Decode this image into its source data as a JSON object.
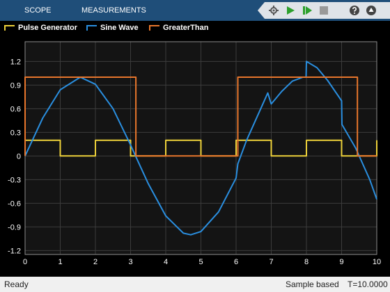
{
  "toolstrip": {
    "tabs": [
      "SCOPE",
      "MEASUREMENTS"
    ],
    "icons": [
      "settings-icon",
      "run-icon",
      "step-forward-icon",
      "stop-icon",
      "help-icon",
      "undock-icon"
    ]
  },
  "legend": [
    {
      "name": "Pulse Generator",
      "color": "#edd13a"
    },
    {
      "name": "Sine Wave",
      "color": "#2a8fe0"
    },
    {
      "name": "GreaterThan",
      "color": "#e8762c"
    }
  ],
  "chart_data": {
    "type": "line",
    "xlim": [
      0,
      10
    ],
    "ylim": [
      -1.25,
      1.45
    ],
    "x_ticks": [
      "0",
      "1",
      "2",
      "3",
      "4",
      "5",
      "6",
      "7",
      "8",
      "9",
      "10"
    ],
    "y_ticks": [
      "-1.2",
      "-0.9",
      "-0.6",
      "-0.3",
      "0",
      "0.3",
      "0.6",
      "0.9",
      "1.2"
    ],
    "grid": true,
    "series": [
      {
        "name": "Pulse Generator",
        "color": "#edd13a",
        "x": [
          0,
          1,
          1,
          2,
          2,
          3,
          3,
          4,
          4,
          5,
          5,
          6,
          6,
          7,
          7,
          8,
          8,
          9,
          9,
          10,
          10
        ],
        "y": [
          0.2,
          0.2,
          0,
          0,
          0.2,
          0.2,
          0,
          0,
          0.2,
          0.2,
          0,
          0,
          0.2,
          0.2,
          0,
          0,
          0.2,
          0.2,
          0,
          0,
          0.2
        ]
      },
      {
        "name": "Sine Wave",
        "color": "#2a8fe0",
        "x": [
          0,
          0.5,
          1,
          1.57,
          2,
          2.5,
          3,
          3.14,
          3.5,
          4,
          4.5,
          4.71,
          5,
          5.5,
          6,
          6.05,
          6.3,
          6.6,
          6.9,
          6.97,
          7,
          7.3,
          7.6,
          7.9,
          7.99,
          8,
          8.3,
          8.6,
          9,
          9.01,
          9.4,
          9.8,
          10
        ],
        "y": [
          0,
          0.48,
          0.84,
          1.0,
          0.91,
          0.6,
          0.14,
          0,
          -0.35,
          -0.76,
          -0.98,
          -1.0,
          -0.96,
          -0.71,
          -0.28,
          -0.1,
          0.2,
          0.5,
          0.8,
          0.7,
          0.66,
          0.82,
          0.95,
          1.0,
          1.0,
          1.2,
          1.12,
          0.96,
          0.7,
          0.4,
          0.1,
          -0.3,
          -0.55
        ]
      },
      {
        "name": "GreaterThan",
        "color": "#e8762c",
        "x": [
          0,
          0,
          3.15,
          3.15,
          6.05,
          6.05,
          9.45,
          9.45,
          10
        ],
        "y": [
          0,
          1,
          1,
          0,
          0,
          1,
          1,
          0,
          0
        ]
      }
    ]
  },
  "status": {
    "left": "Ready",
    "mode": "Sample based",
    "time": "T=10.0000"
  }
}
